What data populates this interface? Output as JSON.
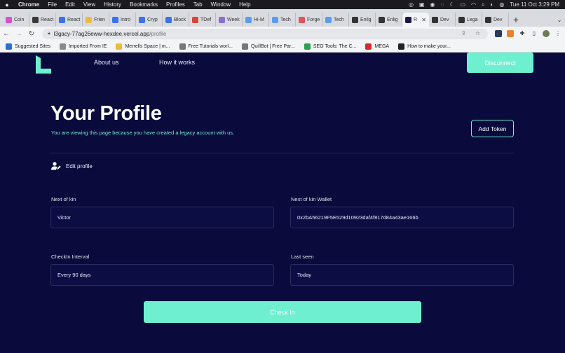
{
  "menubar": {
    "app": "Chrome",
    "items": [
      "File",
      "Edit",
      "View",
      "History",
      "Bookmarks",
      "Profiles",
      "Tab",
      "Window",
      "Help"
    ],
    "clock": "Tue 11 Oct  3:29 PM"
  },
  "tabs": [
    {
      "label": "Coin",
      "color": "#d94fd1"
    },
    {
      "label": "React",
      "color": "#3a3a3a"
    },
    {
      "label": "React",
      "color": "#3b73e8"
    },
    {
      "label": "Frien",
      "color": "#f0b93b"
    },
    {
      "label": "Intro",
      "color": "#3b73e8"
    },
    {
      "label": "Cryp",
      "color": "#3b73e8"
    },
    {
      "label": "Block",
      "color": "#3b73e8"
    },
    {
      "label": "TDef",
      "color": "#d44638"
    },
    {
      "label": "Week",
      "color": "#8a6fd1"
    },
    {
      "label": "Hi-M",
      "color": "#5a9cf0"
    },
    {
      "label": "Tech",
      "color": "#5a9cf0"
    },
    {
      "label": "Forge",
      "color": "#e05555"
    },
    {
      "label": "Tech",
      "color": "#5a9cf0"
    },
    {
      "label": "Enlig",
      "color": "#333333"
    },
    {
      "label": "Enlig",
      "color": "#333333"
    },
    {
      "label": "R",
      "color": "#1a1a4a",
      "active": true
    },
    {
      "label": "Dev",
      "color": "#333333"
    },
    {
      "label": "Lega",
      "color": "#333333"
    },
    {
      "label": "Dev",
      "color": "#333333"
    }
  ],
  "address": {
    "host": "l3gacy-77ag26eww-hexdee.vercel.app",
    "path": "/profile"
  },
  "bookmarks": [
    {
      "label": "Suggested Sites",
      "color": "#2b6ed6"
    },
    {
      "label": "Imported From IE",
      "color": "#8a8a8a"
    },
    {
      "label": "Merrells Space | m...",
      "color": "#f0b93b"
    },
    {
      "label": "Free Tutorials worl...",
      "color": "#777777"
    },
    {
      "label": "QuillBot | Free Par...",
      "color": "#777777"
    },
    {
      "label": "SEO Tools: The C...",
      "color": "#2e9e4f"
    },
    {
      "label": "MEGA",
      "color": "#d9272e"
    },
    {
      "label": "How to make your...",
      "color": "#222222"
    }
  ],
  "app": {
    "nav": {
      "about": "About us",
      "how": "How it works"
    },
    "disconnect_label": "Disconnect",
    "title": "Your Profile",
    "subtitle": "You are viewing this page because you have created a legacy account with us.",
    "add_token_label": "Add Token",
    "edit_profile_label": "Edit profile",
    "fields": {
      "next_of_kin": {
        "label": "Next of kin",
        "value": "Victor"
      },
      "next_of_kin_wallet": {
        "label": "Next of kin Wallet",
        "value": "0x2bA56219F5E529d10923daf4f817d84a43ae166b"
      },
      "checkin_interval": {
        "label": "CheckIn Interval",
        "value": "Every 90 days"
      },
      "last_seen": {
        "label": "Last seen",
        "value": "Today"
      }
    },
    "checkin_label": "Check In",
    "accent": "#6ef0d0",
    "background": "#0a0a3c"
  }
}
